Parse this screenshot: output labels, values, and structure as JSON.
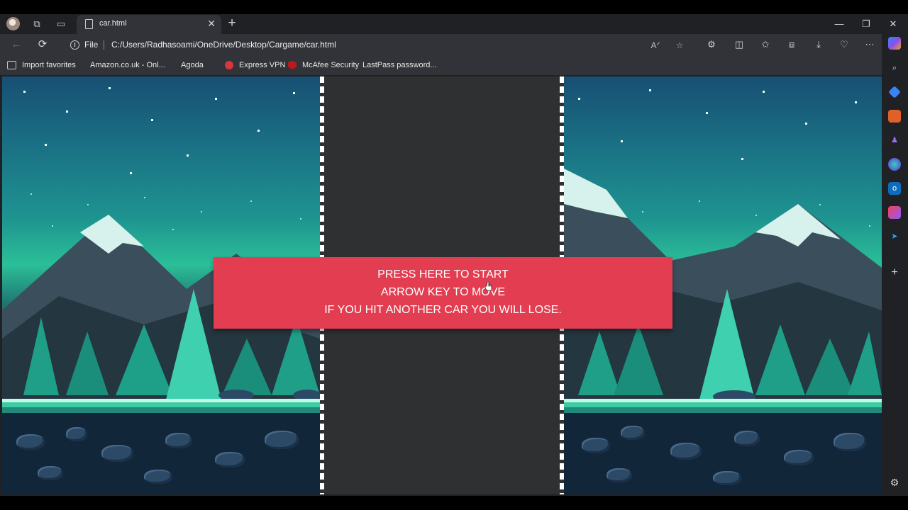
{
  "browser": {
    "tab": {
      "title": "car.html",
      "close_glyph": "✕"
    },
    "new_tab_glyph": "+",
    "window_controls": {
      "minimize": "—",
      "restore": "❐",
      "close": "✕"
    },
    "address": {
      "scheme_label": "File",
      "url": "C:/Users/Radhasoami/OneDrive/Desktop/Cargame/car.html"
    },
    "favorites": [
      {
        "label": "Import favorites",
        "icon": "import-icon"
      },
      {
        "label": "Amazon.co.uk - Onl...",
        "icon": "page-icon"
      },
      {
        "label": "Agoda",
        "icon": "page-icon"
      },
      {
        "label": "Express VPN",
        "icon": "vpn-icon"
      },
      {
        "label": "McAfee Security",
        "icon": "mcafee-icon"
      },
      {
        "label": "LastPass password...",
        "icon": "page-icon"
      }
    ],
    "toolbar_icons": [
      "read-aloud-icon",
      "favorite-star-icon",
      "extensions-icon",
      "split-screen-icon",
      "favorites-icon",
      "collections-icon",
      "downloads-icon",
      "browser-essentials-icon",
      "more-options-icon",
      "copilot-icon"
    ],
    "sidebar_icons": [
      "search-icon",
      "tag-icon",
      "briefcase-icon",
      "games-icon",
      "microsoft365-icon",
      "outlook-icon",
      "designer-icon",
      "send-icon",
      "add-icon",
      "settings-icon"
    ]
  },
  "game": {
    "start_banner": {
      "line1": "PRESS HERE TO START",
      "line2": "ARROW KEY TO MOVE",
      "line3": "IF YOU HIT ANOTHER CAR YOU WILL LOSE."
    },
    "colors": {
      "banner": "#e23d51",
      "road": "#2f3032",
      "lane": "#ffffff"
    }
  }
}
